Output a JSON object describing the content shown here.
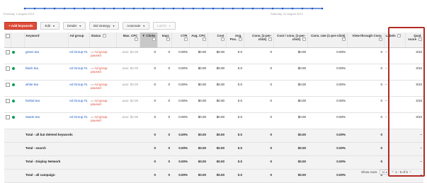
{
  "chart": {
    "start_date": "Thursday, 1 August 2013",
    "end_date": "Saturday, 31 August 2013",
    "line_color": "#1a57c4",
    "point_count": 31
  },
  "toolbar": {
    "add_keywords": "+ Add keywords",
    "edit": "Edit",
    "details": "Details",
    "bid_strategy": "Bid strategy",
    "automate": "Automate",
    "labels": "Labels"
  },
  "columns": {
    "keyword": "Keyword",
    "ad_group": "Ad group",
    "status": "Status",
    "max_cpc": "Max. CPC",
    "clicks": "Clicks",
    "impr": "Impr.",
    "ctr": "CTR",
    "avg_cpc": "Avg. CPC",
    "cost": "Cost",
    "avg_pos": "Avg. Pos.",
    "conv_1pc": "Conv. (1-per-click)",
    "cost_conv": "Cost / conv. (1-per-click)",
    "conv_rate": "Conv. rate (1-per-click)",
    "view_through": "View-through Conv.",
    "labels": "Labels",
    "qual_score": "Qual. score"
  },
  "help_glyph": "?",
  "rows": [
    {
      "keyword": "green tea",
      "ad_group": "Ad Group #1",
      "status": "Ad group paused",
      "max_cpc": "auto: $2.09",
      "clicks": "0",
      "impr": "0",
      "ctr": "0.00%",
      "avg_cpc": "$0.00",
      "cost": "$0.00",
      "avg_pos": "0.0",
      "conv": "0",
      "cost_conv": "$0.00",
      "conv_rate": "0.00%",
      "view_through": "0",
      "labels": "–",
      "qs": "3/10"
    },
    {
      "keyword": "black tea",
      "ad_group": "Ad Group #1",
      "status": "Ad group paused",
      "max_cpc": "auto: $2.09",
      "clicks": "0",
      "impr": "0",
      "ctr": "0.00%",
      "avg_cpc": "$0.00",
      "cost": "$0.00",
      "avg_pos": "0.0",
      "conv": "0",
      "cost_conv": "$0.00",
      "conv_rate": "0.00%",
      "view_through": "0",
      "labels": "–",
      "qs": "3/10"
    },
    {
      "keyword": "white tea",
      "ad_group": "Ad Group #1",
      "status": "Ad group paused",
      "max_cpc": "auto: $2.09",
      "clicks": "0",
      "impr": "0",
      "ctr": "0.00%",
      "avg_cpc": "$0.00",
      "cost": "$0.00",
      "avg_pos": "0.0",
      "conv": "0",
      "cost_conv": "$0.00",
      "conv_rate": "0.00%",
      "view_through": "0",
      "labels": "–",
      "qs": "3/10"
    },
    {
      "keyword": "herbal tea",
      "ad_group": "Ad Group #1",
      "status": "Ad group paused",
      "max_cpc": "auto: $2.09",
      "clicks": "0",
      "impr": "0",
      "ctr": "0.00%",
      "avg_cpc": "$0.00",
      "cost": "$0.00",
      "avg_pos": "0.0",
      "conv": "0",
      "cost_conv": "$0.00",
      "conv_rate": "0.00%",
      "view_through": "0",
      "labels": "–",
      "qs": "4/10"
    },
    {
      "keyword": "Sweet tea",
      "ad_group": "Ad Group #1",
      "status": "Ad group paused",
      "max_cpc": "auto: $2.09",
      "clicks": "0",
      "impr": "0",
      "ctr": "0.00%",
      "avg_cpc": "$0.00",
      "cost": "$0.00",
      "avg_pos": "0.0",
      "conv": "0",
      "cost_conv": "$0.00",
      "conv_rate": "0.00%",
      "view_through": "0",
      "labels": "–",
      "qs": "3/10"
    }
  ],
  "totals": [
    {
      "label": "Total - all but deleted keywords",
      "clicks": "0",
      "impr": "0",
      "ctr": "0.00%",
      "avg_cpc": "$0.00",
      "cost": "$0.00",
      "avg_pos": "0.0",
      "conv": "0",
      "cost_conv": "$0.00",
      "conv_rate": "0.00%",
      "view_through": "0",
      "qs": "–"
    },
    {
      "label": "Total - search",
      "clicks": "0",
      "impr": "0",
      "ctr": "0.00%",
      "avg_cpc": "$0.00",
      "cost": "$0.00",
      "avg_pos": "0.0",
      "conv": "0",
      "cost_conv": "$0.00",
      "conv_rate": "0.00%",
      "view_through": "0",
      "qs": "–"
    },
    {
      "label": "Total - Display Network",
      "clicks": "0",
      "impr": "0",
      "ctr": "0.00%",
      "avg_cpc": "$0.00",
      "cost": "$0.00",
      "avg_pos": "0.0",
      "conv": "0",
      "cost_conv": "$0.00",
      "conv_rate": "0.00%",
      "view_through": "0",
      "qs": "–"
    },
    {
      "label": "Total - all campaign",
      "clicks": "0",
      "impr": "0",
      "ctr": "0.00%",
      "avg_cpc": "$0.00",
      "cost": "$0.00",
      "avg_pos": "0.0",
      "conv": "0",
      "cost_conv": "$0.00",
      "conv_rate": "0.00%",
      "view_through": "0",
      "qs": "–"
    }
  ],
  "footer": {
    "show_rows_label": "Show rows:",
    "show_rows_value": "50",
    "range": "1 - 5 of 5"
  },
  "colors": {
    "highlight_box": "#b32a24",
    "status_red": "#dd4b39",
    "link_blue": "#1a57c4",
    "enabled_dot": "#0a9d58"
  }
}
